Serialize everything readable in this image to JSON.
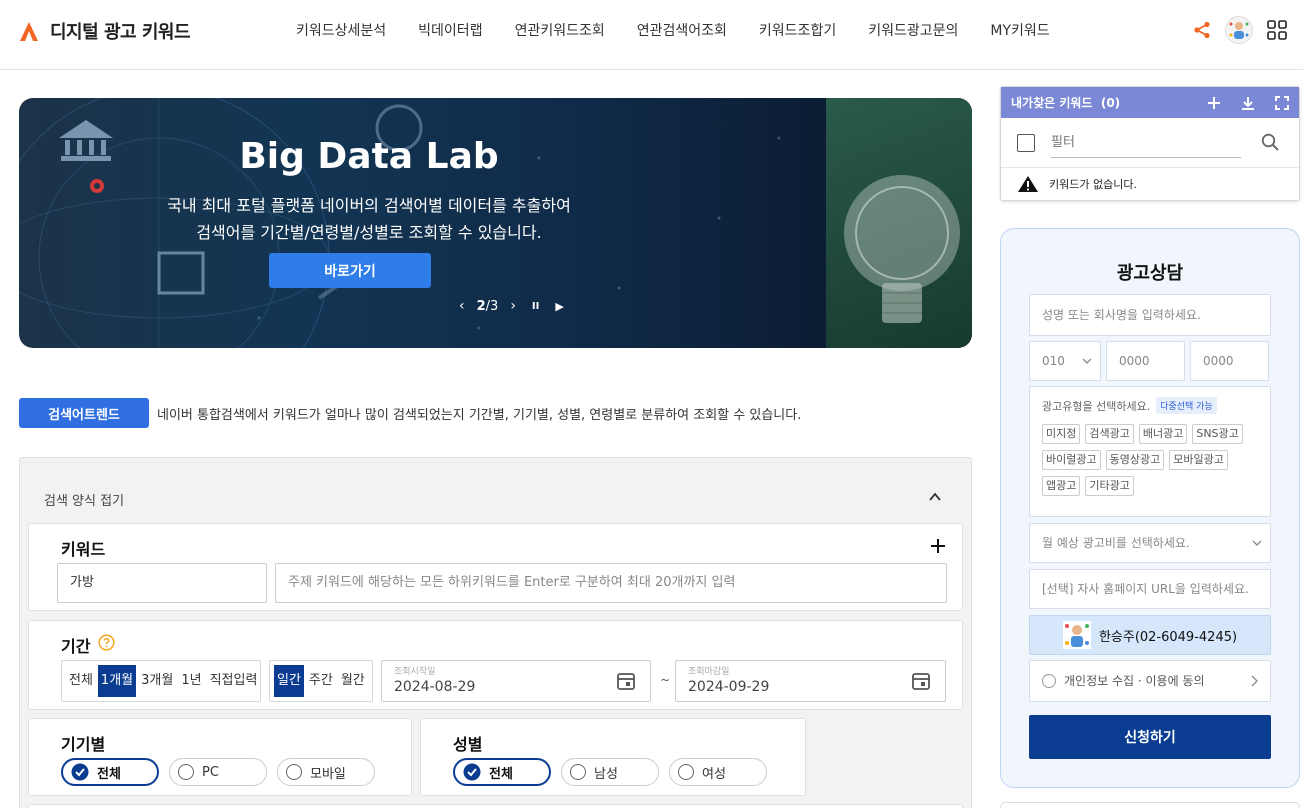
{
  "header": {
    "logo_text": "디지털 광고 키워드",
    "nav": [
      "키워드상세분석",
      "빅데이터랩",
      "연관키워드조회",
      "연관검색어조회",
      "키워드조합기",
      "키워드광고문의",
      "MY키워드"
    ],
    "colors": {
      "logo": "#f26522",
      "share": "#f26522"
    }
  },
  "banner": {
    "title": "Big Data Lab",
    "desc_line1": "국내 최대 포털 플랫폼 네이버의 검색어별 데이터를 추출하여",
    "desc_line2": "검색어를 기간별/연령별/성별로 조회할 수 있습니다.",
    "button": "바로가기",
    "pager_current": "2",
    "pager_total": "/3",
    "prev": "‹",
    "next": "›",
    "pause": "II",
    "play": "▶"
  },
  "trend": {
    "badge": "검색어트렌드",
    "desc": "네이버 통합검색에서 키워드가 얼마나 많이 검색되었는지 기간별, 기기별, 성별, 연령별로 분류하여 조회할 수 있습니다."
  },
  "form": {
    "fold_label": "검색 양식 접기",
    "keyword": {
      "label": "키워드",
      "value": "가방",
      "sub_placeholder": "주제 키워드에 해당하는 모든 하위키워드를 Enter로 구분하여 최대 20개까지 입력"
    },
    "period": {
      "label": "기간",
      "ranges": [
        "전체",
        "1개월",
        "3개월",
        "1년",
        "직접입력"
      ],
      "active_range": "1개월",
      "units": [
        "일간",
        "주간",
        "월간"
      ],
      "active_unit": "일간",
      "start_label": "조회시작일",
      "start_value": "2024-08-29",
      "end_label": "조회마감일",
      "end_value": "2024-09-29",
      "tilde": "~"
    },
    "device": {
      "label": "기기별",
      "options": [
        "전체",
        "PC",
        "모바일"
      ],
      "selected": "전체"
    },
    "gender": {
      "label": "성별",
      "options": [
        "전체",
        "남성",
        "여성"
      ],
      "selected": "전체"
    }
  },
  "mykeywords": {
    "title": "내가찾은 키워드",
    "count": "(0)",
    "filter_placeholder": "필터",
    "empty": "키워드가 없습니다."
  },
  "consult": {
    "title": "광고상담",
    "name_placeholder": "성명 또는 회사명을 입력하세요.",
    "phone_prefix": "010",
    "phone_mid_placeholder": "0000",
    "phone_last_placeholder": "0000",
    "types_label": "광고유형을 선택하세요.",
    "multi_badge": "다중선택 가능",
    "types": [
      "미지정",
      "검색광고",
      "배너광고",
      "SNS광고",
      "바이럴광고",
      "동영상광고",
      "모바일광고",
      "앱광고",
      "기타광고"
    ],
    "budget_placeholder": "월 예상 광고비를 선택하세요.",
    "url_placeholder": "[선택] 자사 홈페이지 URL을 입력하세요.",
    "contact": "한승주(02-6049-4245)",
    "agree": "개인정보 수집 · 이용에 동의",
    "submit": "신청하기",
    "colors": {
      "primary": "#0a3d91",
      "accent": "#2f6fe0"
    }
  }
}
